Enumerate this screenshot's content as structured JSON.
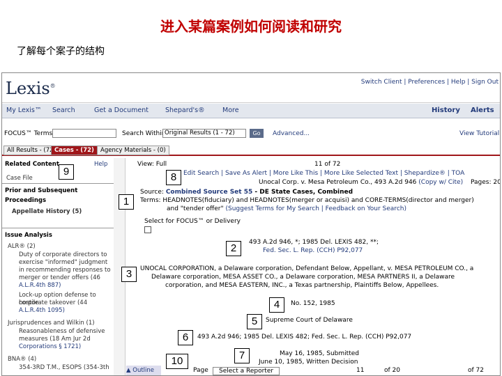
{
  "slide": {
    "title": "进入某篇案例如何阅读和研究",
    "subtitle": "了解每个案子的结构"
  },
  "lexis": {
    "logo": "Lexis",
    "logo_mark": "®",
    "top_links": "Switch Client | Preferences | Help | Sign Out",
    "nav": [
      "My Lexis™",
      "Search",
      "Get a Document",
      "Shepard's®",
      "More"
    ],
    "history": "History",
    "alerts": "Alerts",
    "focus_label": "FOCUS™ Terms",
    "search_within": "Search Within",
    "search_within_value": "Original Results (1 - 72)",
    "go": "Go",
    "advanced": "Advanced...",
    "view_tutorial": "View Tutorial",
    "result_tabs": [
      "All Results - (72)",
      "Cases - (72)",
      "Agency Materials - (0)"
    ],
    "side": {
      "related": "Related Content",
      "help": "Help",
      "case_file": "Case File",
      "prior": "Prior and Subsequent",
      "proceedings": "Proceedings",
      "appellate": "Appellate History",
      "appellate_count": "(5)",
      "issue": "Issue Analysis",
      "alr": "ALR® (2)",
      "alr_text1": "Duty of corporate directors to",
      "alr_text2": "exercise \"informed\" judgment",
      "alr_text3": "in recommending responses to",
      "alr_text4": "merger or tender offers (46",
      "alr_text5": "A.L.R.4th 887)",
      "alr_text6": "Lock-up option defense to hostile",
      "alr_text7": "corporate takeover (44",
      "alr_text8": "A.L.R.4th 1095)",
      "juris": "Jurisprudences and Wilkin (1)",
      "juris_text1": "Reasonableness of defensive",
      "juris_text2": "measures (18 Am Jur 2d",
      "juris_text3": "Corporations § 1721)",
      "bna": "BNA® (4)",
      "bna_text": "354-3RD T.M., ESOPS (354-3th",
      "outline": "Outline"
    },
    "main": {
      "view": "View: Full",
      "page_of": "11 of 72",
      "actions": "Edit Search | Save As Alert | More Like This | More Like Selected Text | Shepardize® | TOA",
      "case_cite": "Unocal Corp. v. Mesa Petroleum Co., 493 A.2d 946",
      "copy_cite": "(Copy w/ Cite)",
      "pages": "Pages: 20",
      "source_label": "Source:",
      "source_value": "Combined Source Set 55",
      "source_rest": " - DE State Cases, Combined",
      "terms_label": "Terms:",
      "terms_line1": "HEADNOTES(fiduciary) and HEADNOTES(merger or acquisi) and CORE-TERMS(director and merger)",
      "terms_line2": "and \"tender offer\"",
      "terms_links": "(Suggest Terms for My Search | Feedback on Your Search)",
      "select_focus": "Select for FOCUS™ or Delivery",
      "cite1": "493 A.2d 946, *; 1985 Del. LEXIS 482, **;",
      "cite2": "Fed. Sec. L. Rep. (CCH) P92,077",
      "parties1": "UNOCAL CORPORATION, a Delaware corporation, Defendant Below, Appellant, v. MESA PETROLEUM CO., a",
      "parties2": "Delaware corporation, MESA ASSET CO., a Delaware corporation, MESA PARTNERS II, a Delaware",
      "parties3": "corporation, and MESA EASTERN, INC., a Texas partnership, Plaintiffs Below, Appellees.",
      "docket": "No. 152, 1985",
      "court": "Supreme Court of Delaware",
      "citation": "493 A.2d 946; 1985 Del. LEXIS 482; Fed. Sec. L. Rep. (CCH) P92,077",
      "dates1": "May 16, 1985, Submitted",
      "dates2": "June 10, 1985, Written Decision",
      "page_label": "Page",
      "reporter": "Select a Reporter",
      "page_num": "11",
      "of_num": "of 20",
      "of_72": "of 72"
    }
  },
  "callouts": [
    "9",
    "8",
    "1",
    "2",
    "3",
    "4",
    "5",
    "6",
    "7",
    "10"
  ]
}
